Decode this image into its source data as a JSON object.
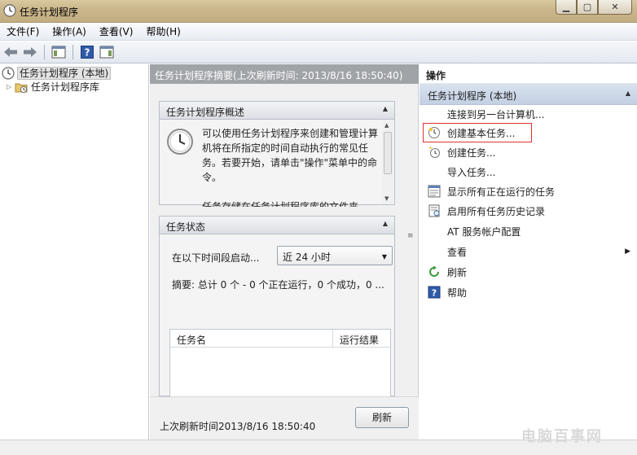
{
  "window": {
    "title": "任务计划程序",
    "controls": [
      "minimize",
      "maximize",
      "close"
    ]
  },
  "menu": [
    "文件(F)",
    "操作(A)",
    "查看(V)",
    "帮助(H)"
  ],
  "tree": {
    "root": "任务计划程序 (本地)",
    "library": "任务计划程序库"
  },
  "middle": {
    "header": "任务计划程序摘要(上次刷新时间: 2013/8/16 18:50:40)",
    "overview": {
      "title": "任务计划程序概述",
      "text": "可以使用任务计划程序来创建和管理计算机将在所指定的时间自动执行的常见任务。若要开始，请单击\"操作\"菜单中的命令。",
      "text2": "任务存储在任务计划程序库的文件夹"
    },
    "status": {
      "title": "任务状态",
      "period_label": "在以下时间段启动...",
      "period_value": "近 24 小时",
      "summary": "摘要: 总计 0 个 - 0 个正在运行，0 个成功，0 ...",
      "col_name": "任务名",
      "col_result": "运行结果"
    },
    "footer": {
      "last_refresh": "上次刷新时间2013/8/16 18:50:40",
      "refresh_button": "刷新"
    }
  },
  "actions": {
    "title": "操作",
    "group": "任务计划程序 (本地)",
    "items": [
      {
        "label": "连接到另一台计算机...",
        "icon": "none"
      },
      {
        "label": "创建基本任务...",
        "icon": "basic-task-icon"
      },
      {
        "label": "创建任务...",
        "icon": "task-icon"
      },
      {
        "label": "导入任务...",
        "icon": "none"
      },
      {
        "label": "显示所有正在运行的任务",
        "icon": "running-tasks-icon"
      },
      {
        "label": "启用所有任务历史记录",
        "icon": "history-icon"
      },
      {
        "label": "AT 服务帐户配置",
        "icon": "none"
      },
      {
        "label": "查看",
        "icon": "none"
      },
      {
        "label": "刷新",
        "icon": "refresh-icon"
      },
      {
        "label": "帮助",
        "icon": "help-icon"
      }
    ]
  },
  "watermark": "电脑百事网"
}
